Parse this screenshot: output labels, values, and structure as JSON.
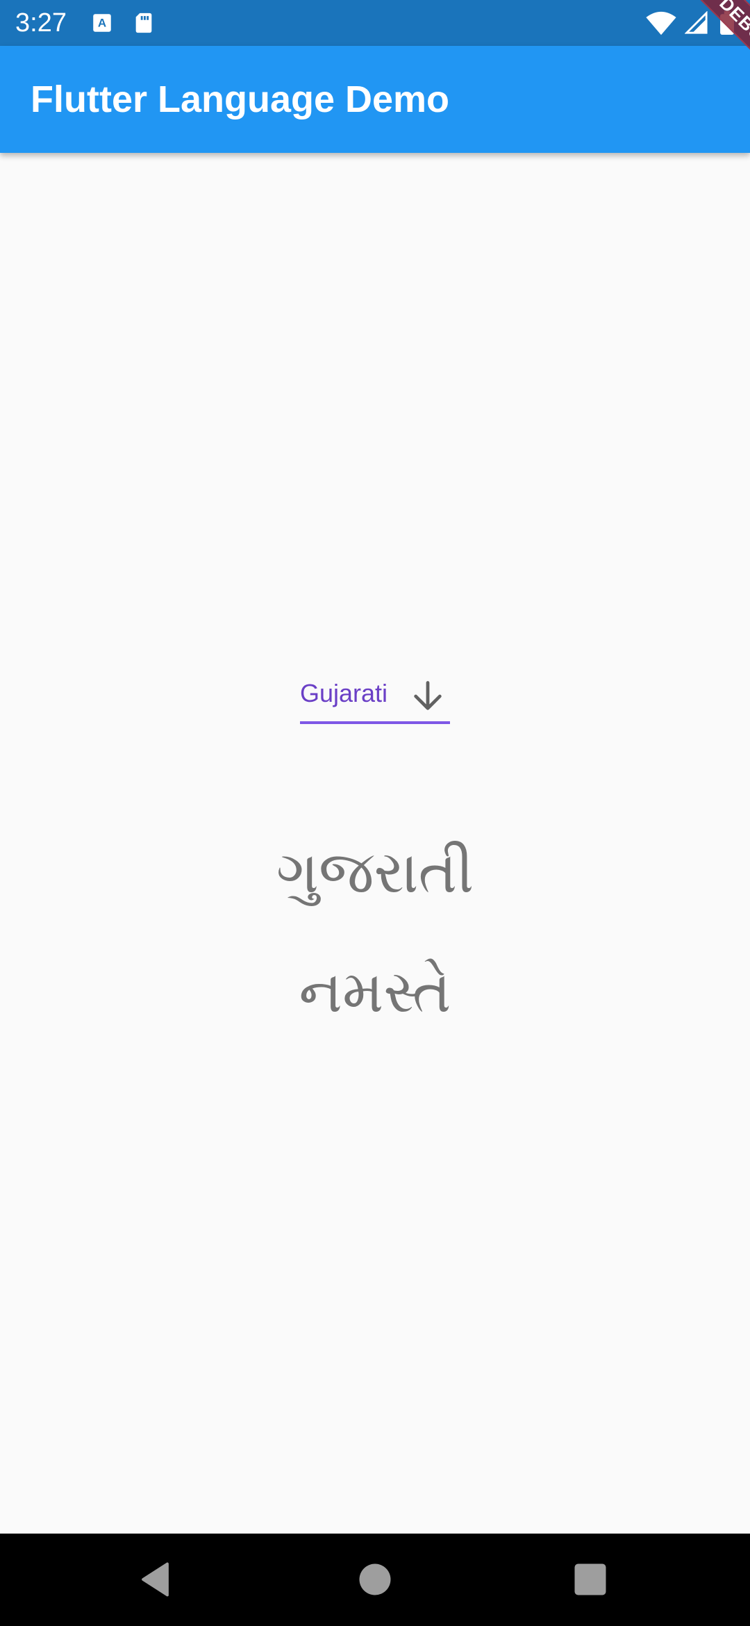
{
  "status_bar": {
    "time": "3:27",
    "icons": [
      "text-input-icon",
      "sd-card-icon",
      "wifi-icon",
      "signal-icon",
      "battery-icon"
    ],
    "background": "#1a74bb"
  },
  "app_bar": {
    "title": "Flutter Language Demo",
    "background": "#2196f3"
  },
  "debug_banner": {
    "label": "DEBUG"
  },
  "language_dropdown": {
    "selected": "Gujarati",
    "icon": "arrow-down-icon",
    "accent": "#7e57e6"
  },
  "content": {
    "language_name": "ગુજરાતી",
    "greeting": "નમસ્તે",
    "text_color": "#757575"
  },
  "nav_bar": {
    "buttons": [
      "back-icon",
      "home-icon",
      "recents-icon"
    ]
  }
}
